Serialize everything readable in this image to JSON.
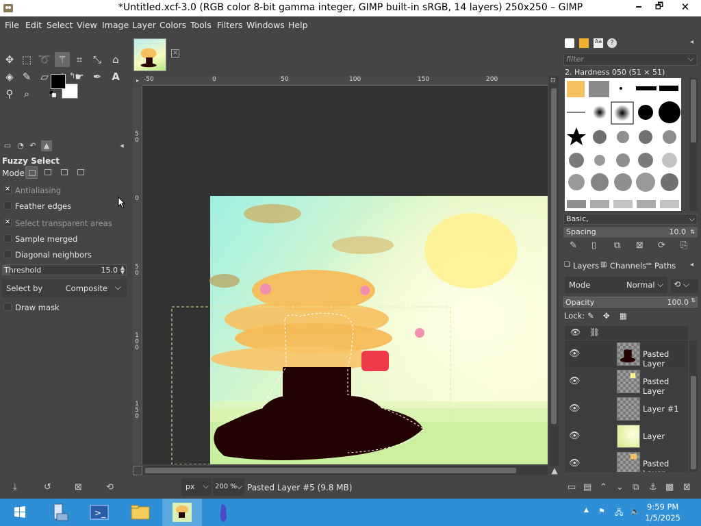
{
  "window": {
    "title": "*Untitled.xcf-3.0 (RGB color 8-bit gamma integer, GIMP built-in sRGB, 14 layers) 250x250 – GIMP",
    "minimize": "🗕",
    "maximize": "🗗",
    "close": "🗙"
  },
  "menu": [
    "File",
    "Edit",
    "Select",
    "View",
    "Image",
    "Layer",
    "Colors",
    "Tools",
    "Filters",
    "Windows",
    "Help"
  ],
  "tool_options": {
    "title": "Fuzzy Select",
    "mode_label": "Mode:",
    "antialiasing": "Antialiasing",
    "feather_edges": "Feather edges",
    "select_transparent": "Select transparent areas",
    "sample_merged": "Sample merged",
    "diagonal_neighbors": "Diagonal neighbors",
    "threshold_label": "Threshold",
    "threshold_value": "15.0",
    "threshold_fraction": 0.059,
    "select_by_label": "Select by",
    "select_by_value": "Composite",
    "draw_mask": "Draw mask",
    "checked": {
      "antialiasing": true,
      "feather_edges": false,
      "select_transparent": true,
      "sample_merged": false,
      "diagonal_neighbors": false,
      "draw_mask": false
    }
  },
  "ruler": {
    "top_labels": [
      "-50",
      "0",
      "50",
      "100",
      "150",
      "200"
    ],
    "left_labels": [
      "5\n0",
      "0",
      "5\n0",
      "1\n0\n0",
      "1\n5\n0"
    ]
  },
  "status": {
    "unit": "px",
    "zoom": "200 %",
    "text": "Pasted Layer #5 (9.8 MB)"
  },
  "brushes": {
    "filter_placeholder": "filter",
    "current": "2. Hardness 050 (51 × 51)",
    "tag": "Basic,",
    "spacing_label": "Spacing",
    "spacing_value": "10.0"
  },
  "layers_panel": {
    "tabs": [
      "Layers",
      "Channels",
      "Paths"
    ],
    "mode_label": "Mode",
    "mode_value": "Normal",
    "opacity_label": "Opacity",
    "opacity_value": "100.0",
    "lock_label": "Lock:",
    "layers": [
      {
        "name": "Pasted Layer",
        "selected": true
      },
      {
        "name": "Pasted Layer",
        "selected": false
      },
      {
        "name": "Layer #1",
        "selected": false
      },
      {
        "name": "Layer",
        "selected": false
      },
      {
        "name": "Pasted Layer",
        "selected": false
      }
    ]
  },
  "taskbar": {
    "time": "9:59 PM",
    "date": "1/5/2025"
  }
}
